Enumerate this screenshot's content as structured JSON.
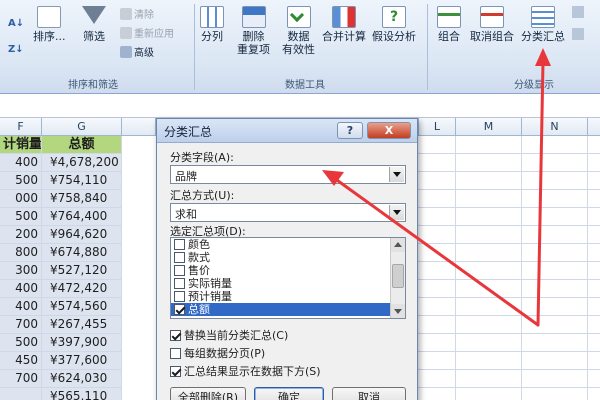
{
  "ribbon": {
    "sort_za_label": "Z↓",
    "sort_label": "排序...",
    "filter_label": "筛选",
    "clear_label": "清除",
    "reapply_label": "重新应用",
    "advanced_label": "高级",
    "group_sort_filter": "排序和筛选",
    "text_to_columns_label": "分列",
    "remove_dup_label_1": "删除",
    "remove_dup_label_2": "重复项",
    "data_valid_label_1": "数据",
    "data_valid_label_2": "有效性",
    "consolidate_label": "合并计算",
    "whatif_label": "假设分析",
    "group_data_tools": "数据工具",
    "group_label": "组合",
    "ungroup_label": "取消组合",
    "subtotal_label": "分类汇总",
    "group_outline": "分级显示"
  },
  "sheet": {
    "col_headers": [
      "F",
      "G",
      "",
      "L",
      "M",
      "N"
    ],
    "header_row": [
      "计销量",
      "总额"
    ],
    "rows": [
      [
        "400",
        "¥4,678,200"
      ],
      [
        "500",
        "¥754,110"
      ],
      [
        "000",
        "¥758,840"
      ],
      [
        "500",
        "¥764,400"
      ],
      [
        "200",
        "¥964,620"
      ],
      [
        "800",
        "¥674,880"
      ],
      [
        "300",
        "¥527,120"
      ],
      [
        "400",
        "¥472,420"
      ],
      [
        "400",
        "¥574,560"
      ],
      [
        "700",
        "¥267,455"
      ],
      [
        "500",
        "¥397,900"
      ],
      [
        "450",
        "¥377,600"
      ],
      [
        "700",
        "¥624,030"
      ],
      [
        "",
        "¥565,110"
      ]
    ]
  },
  "dialog": {
    "title": "分类汇总",
    "help": "?",
    "close": "X",
    "field_label": "分类字段(A):",
    "field_value": "品牌",
    "method_label": "汇总方式(U):",
    "method_value": "求和",
    "items_label": "选定汇总项(D):",
    "items": [
      {
        "label": "颜色",
        "checked": false
      },
      {
        "label": "款式",
        "checked": false
      },
      {
        "label": "售价",
        "checked": false
      },
      {
        "label": "实际销量",
        "checked": false
      },
      {
        "label": "预计销量",
        "checked": false
      },
      {
        "label": "总额",
        "checked": true
      }
    ],
    "opt_replace": "替换当前分类汇总(C)",
    "opt_pagebreak": "每组数据分页(P)",
    "opt_summary_below": "汇总结果显示在数据下方(S)",
    "btn_remove_all": "全部删除(R)",
    "btn_ok": "确定",
    "btn_cancel": "取消"
  },
  "colors": {
    "arrow": "#e8373a",
    "header_fill": "#b2d77f",
    "cell_fill": "#dde4f0",
    "selection": "#3169c6"
  }
}
